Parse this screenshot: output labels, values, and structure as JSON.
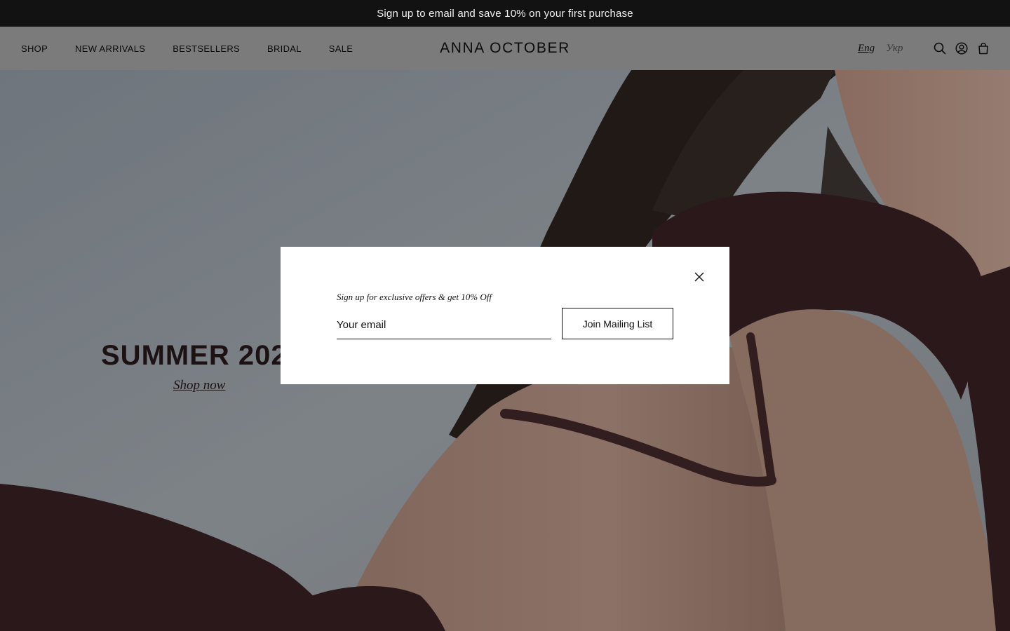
{
  "announcement": {
    "text": "Sign up to email and save 10% on your first purchase"
  },
  "header": {
    "nav": [
      {
        "label": "SHOP"
      },
      {
        "label": "NEW ARRIVALS"
      },
      {
        "label": "BESTSELLERS"
      },
      {
        "label": "BRIDAL"
      },
      {
        "label": "SALE"
      }
    ],
    "logo": "ANNA OCTOBER",
    "languages": {
      "current": "Eng",
      "other": "Укр"
    },
    "icons": [
      "search-icon",
      "account-icon",
      "bag-icon"
    ]
  },
  "hero": {
    "title": "SUMMER 202",
    "link": "Shop now"
  },
  "modal": {
    "heading": "Sign up for exclusive offers & get 10% Off",
    "email_placeholder": "Your email",
    "button_label": "Join Mailing List",
    "close_icon": "close-icon"
  },
  "colors": {
    "announcement_bg": "#121212",
    "header_bg": "#b1b1b1",
    "garment": "#3d2326",
    "backdrop": "#aab2ba",
    "skin": "#c9a493"
  }
}
